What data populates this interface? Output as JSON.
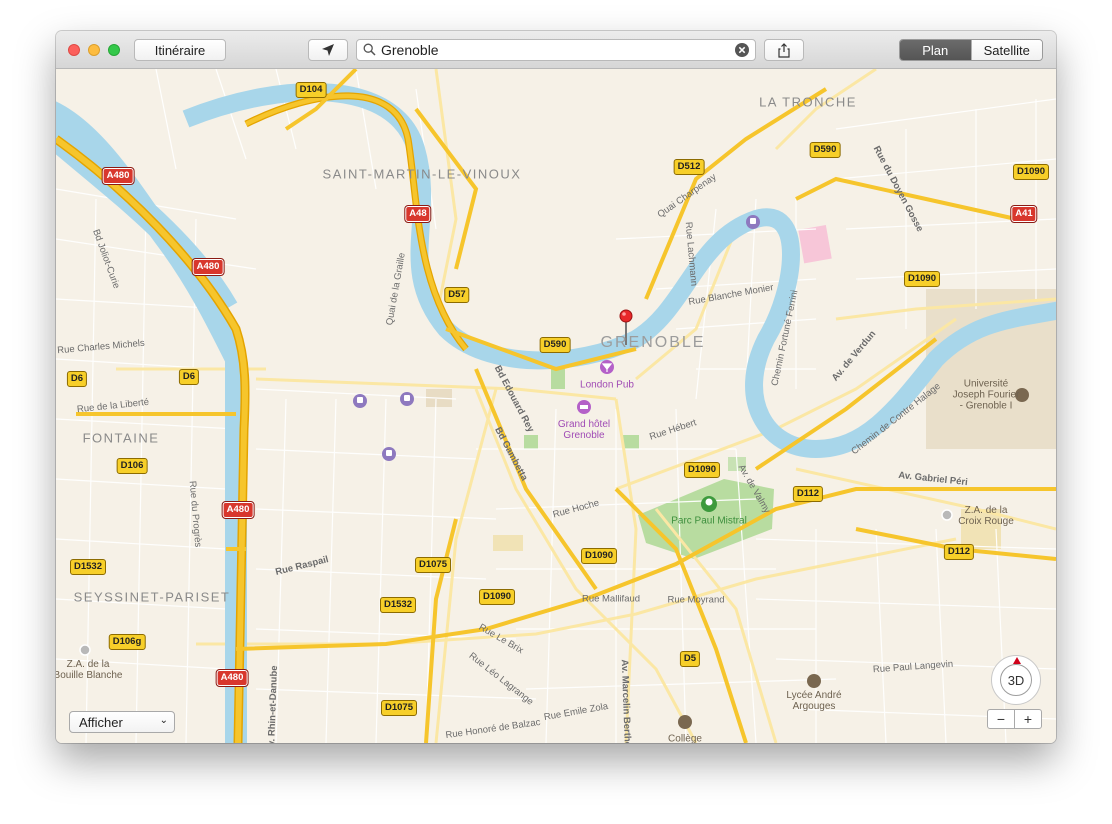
{
  "toolbar": {
    "directions_label": "Itinéraire",
    "location_icon": "location-arrow-icon",
    "search_value": "Grenoble",
    "share_icon": "share-icon",
    "map_mode": [
      "Plan",
      "Satellite"
    ],
    "selected_mode": "Plan"
  },
  "map": {
    "cities": {
      "grenoble": "GRENOBLE",
      "saint_martin": "SAINT-MARTIN-LE-VINOUX",
      "la_tronche": "LA TRONCHE",
      "fontaine": "FONTAINE",
      "seyssinet": "SEYSSINET-PARISET"
    },
    "roads": {
      "a480_1": "A480",
      "a480_2": "A480",
      "a480_3": "A480",
      "a480_4": "A480",
      "a48": "A48",
      "a41": "A41",
      "d104": "D104",
      "d57": "D57",
      "d512": "D512",
      "d590_1": "D590",
      "d590_2": "D590",
      "d1090_1": "D1090",
      "d1090_2": "D1090",
      "d1090_3": "D1090",
      "d1090_4": "D1090",
      "d1090_5": "D1090",
      "d6_1": "D6",
      "d6_2": "D6",
      "d106": "D106",
      "d106g": "D106g",
      "d1532_1": "D1532",
      "d1532_2": "D1532",
      "d1075_1": "D1075",
      "d1075_2": "D1075",
      "d5": "D5",
      "d112_1": "D112",
      "d112_2": "D112"
    },
    "streets": {
      "quai_chorpenay": "Quai Charpenay",
      "quai_graille": "Quai de la Graille",
      "bd_rey": "Bd Edouard Rey",
      "bd_gambetta": "Bd Gambetta",
      "rue_hebert": "Rue Hébert",
      "rue_hoche": "Rue Hoche",
      "rue_mallifaud": "Rue Mallifaud",
      "rue_moyrand": "Rue Moyrand",
      "rue_raspail": "Rue Raspail",
      "rue_michels": "Rue Charles Michels",
      "rue_liberte": "Rue de la Liberté",
      "rue_blanche": "Rue Blanche Monier",
      "av_verdun": "Av. de Verdun",
      "av_peri": "Av. Gabriel Péri",
      "av_berthelot": "Av. Marcelin Berthelot",
      "rue_langevin": "Rue Paul Langevin",
      "bd_joliot": "Bd Joliot-Curie",
      "rue_doyen": "Rue du Doyen Gosse",
      "av_valmy": "Av. de Valmy",
      "chemin_halage": "Chemin de Contre Halage",
      "rue_zola": "Rue Emile Zola",
      "rue_balzac": "Rue Honoré de Balzac",
      "rue_ferrini": "Chemin Fortuné Ferrini",
      "rue_lachmann": "Rue Lachmann",
      "av_rhin": "Av. Rhin-et-Danube",
      "rue_progres": "Rue du Progrès",
      "rue_brix": "Rue Le Brix",
      "rue_lagrange": "Rue Léo Lagrange"
    },
    "pois": {
      "london_pub": "London Pub",
      "hotel": "Grand hôtel\nGrenoble",
      "parc": "Parc Paul Mistral",
      "universite": "Université\nJoseph Fourier\n- Grenoble I",
      "za_croix": "Z.A. de la\nCroix Rouge",
      "za_bouille": "Z.A. de la\nBouille Blanche",
      "lycee": "Lycée André\nArgouges",
      "college": "Collège"
    },
    "display_menu": "Afficher",
    "compass_label": "3D",
    "zoom_out": "−",
    "zoom_in": "+"
  },
  "colors": {
    "water": "#a8d6ea",
    "land": "#f6f1e7",
    "motorway": "#f6c52c",
    "park": "#b8dca0",
    "pin": "#e8282a"
  }
}
